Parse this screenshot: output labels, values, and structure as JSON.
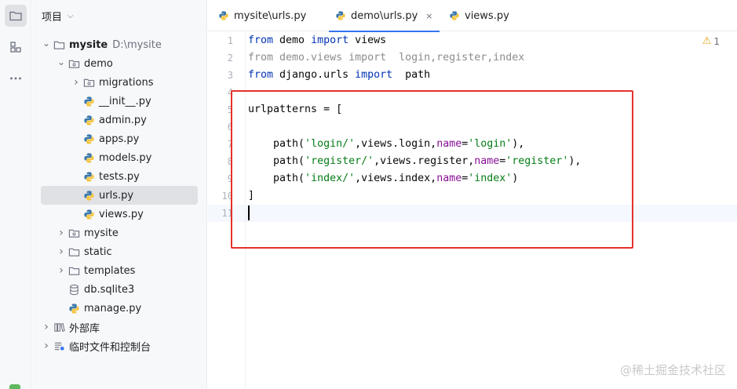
{
  "toolstrip": {
    "buttons": [
      {
        "icon": "folder-icon",
        "active": true
      },
      {
        "icon": "structure-icon",
        "active": false
      },
      {
        "icon": "more-icon",
        "active": false
      }
    ]
  },
  "project": {
    "title": "项目",
    "tree": [
      {
        "label": "mysite",
        "path": "D:\\mysite",
        "type": "folder",
        "expanded": true,
        "bold": true
      },
      {
        "label": "demo",
        "type": "package",
        "expanded": true
      },
      {
        "label": "migrations",
        "type": "package",
        "expanded": false
      },
      {
        "label": "__init__.py",
        "type": "python"
      },
      {
        "label": "admin.py",
        "type": "python"
      },
      {
        "label": "apps.py",
        "type": "python"
      },
      {
        "label": "models.py",
        "type": "python"
      },
      {
        "label": "tests.py",
        "type": "python"
      },
      {
        "label": "urls.py",
        "type": "python",
        "selected": true
      },
      {
        "label": "views.py",
        "type": "python"
      },
      {
        "label": "mysite",
        "type": "package",
        "expanded": false
      },
      {
        "label": "static",
        "type": "folder",
        "expanded": false
      },
      {
        "label": "templates",
        "type": "folder",
        "expanded": false
      },
      {
        "label": "db.sqlite3",
        "type": "database"
      },
      {
        "label": "manage.py",
        "type": "python"
      },
      {
        "label": "外部库",
        "type": "library",
        "expanded": false
      },
      {
        "label": "临时文件和控制台",
        "type": "scratch",
        "expanded": false
      }
    ]
  },
  "tabs": [
    {
      "label": "mysite\\urls.py",
      "active": false
    },
    {
      "label": "demo\\urls.py",
      "active": true,
      "close": "×"
    },
    {
      "label": "views.py",
      "active": false
    }
  ],
  "editor": {
    "warning_count": "1",
    "line_numbers": [
      "1",
      "2",
      "3",
      "4",
      "5",
      "6",
      "7",
      "8",
      "9",
      "10",
      "11"
    ],
    "lines": [
      {
        "tokens": [
          {
            "t": "from",
            "c": "kw"
          },
          {
            "t": " demo ",
            "c": "plain"
          },
          {
            "t": "import",
            "c": "kw"
          },
          {
            "t": " views",
            "c": "plain"
          }
        ]
      },
      {
        "tokens": [
          {
            "t": "from demo.views import  login,register,index",
            "c": "grey"
          }
        ]
      },
      {
        "tokens": [
          {
            "t": "from",
            "c": "kw"
          },
          {
            "t": " django.urls ",
            "c": "plain"
          },
          {
            "t": "import",
            "c": "kw"
          },
          {
            "t": "  path",
            "c": "plain"
          }
        ]
      },
      {
        "tokens": []
      },
      {
        "tokens": [
          {
            "t": "urlpatterns = [",
            "c": "plain"
          }
        ]
      },
      {
        "tokens": []
      },
      {
        "tokens": [
          {
            "t": "    path(",
            "c": "plain"
          },
          {
            "t": "'login/'",
            "c": "str"
          },
          {
            "t": ",views.login,",
            "c": "plain"
          },
          {
            "t": "name",
            "c": "param"
          },
          {
            "t": "=",
            "c": "plain"
          },
          {
            "t": "'login'",
            "c": "str"
          },
          {
            "t": "),",
            "c": "plain"
          }
        ]
      },
      {
        "tokens": [
          {
            "t": "    path(",
            "c": "plain"
          },
          {
            "t": "'register/'",
            "c": "str"
          },
          {
            "t": ",views.register,",
            "c": "plain"
          },
          {
            "t": "name",
            "c": "param"
          },
          {
            "t": "=",
            "c": "plain"
          },
          {
            "t": "'register'",
            "c": "str"
          },
          {
            "t": "),",
            "c": "plain"
          }
        ]
      },
      {
        "tokens": [
          {
            "t": "    path(",
            "c": "plain"
          },
          {
            "t": "'index/'",
            "c": "str"
          },
          {
            "t": ",views.index,",
            "c": "plain"
          },
          {
            "t": "name",
            "c": "param"
          },
          {
            "t": "=",
            "c": "plain"
          },
          {
            "t": "'index'",
            "c": "str"
          },
          {
            "t": ")",
            "c": "plain"
          }
        ]
      },
      {
        "tokens": [
          {
            "t": "]",
            "c": "plain"
          }
        ]
      },
      {
        "tokens": []
      }
    ]
  },
  "watermark": "@稀土掘金技术社区",
  "colors": {
    "accent": "#3574f0",
    "highlight_box": "#e4312b",
    "keyword": "#0033b3",
    "string": "#067d17",
    "param": "#871094"
  }
}
